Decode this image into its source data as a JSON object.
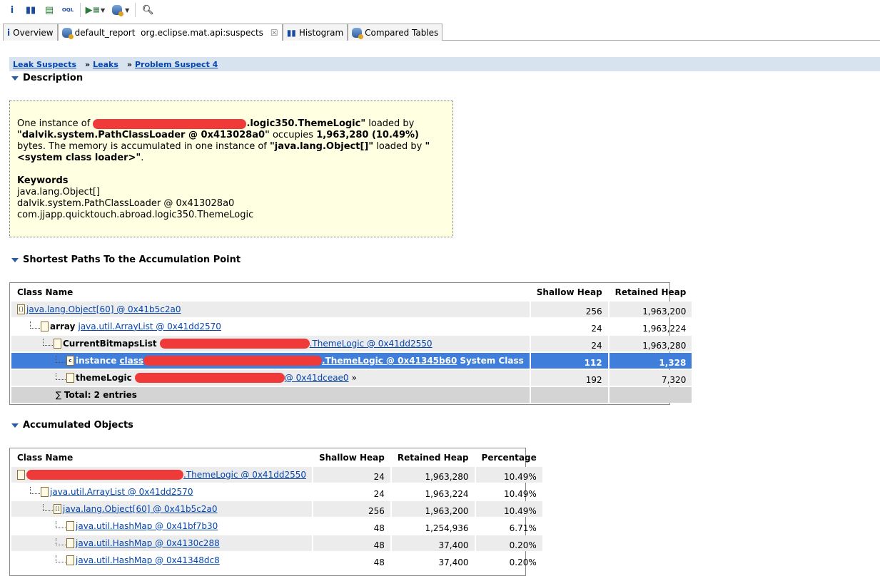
{
  "tabs": [
    {
      "label": "Overview",
      "icon": "info-icon"
    },
    {
      "label": "default_report  org.eclipse.mat.api:suspects",
      "icon": "report-icon",
      "closable": true
    },
    {
      "label": "Histogram",
      "icon": "histogram-icon"
    },
    {
      "label": "Compared Tables",
      "icon": "compare-icon"
    }
  ],
  "breadcrumb": [
    "Leak Suspects",
    "Leaks",
    "Problem Suspect 4"
  ],
  "breadcrumb_sep": "»",
  "description": {
    "title": "Description",
    "p1a": "One instance of ",
    "p1b": ".logic350.ThemeLogic\"",
    "p1c": " loaded by ",
    "p1d": "\"dalvik.system.PathClassLoader @ 0x413028a0\"",
    "p1e": " occupies ",
    "p1f": "1,963,280 (10.49%)",
    "p1g": " bytes. The memory is accumulated in one instance of ",
    "p1h": "\"java.lang.Object[]\"",
    "p1i": " loaded by ",
    "p1j": "\"<system class loader>\"",
    "p1k": ".",
    "kw_title": "Keywords",
    "keywords": [
      "java.lang.Object[]",
      "dalvik.system.PathClassLoader @ 0x413028a0",
      "com.jjapp.quicktouch.abroad.logic350.ThemeLogic"
    ]
  },
  "paths": {
    "title": "Shortest Paths To the Accumulation Point",
    "columns": [
      "Class Name",
      "Shallow Heap",
      "Retained Heap"
    ],
    "rows": [
      {
        "depth": 0,
        "icon": "[]",
        "field": "",
        "link": "java.lang.Object[60] @ 0x41b5c2a0",
        "extra": "",
        "shallow": "256",
        "retained": "1,963,200"
      },
      {
        "depth": 1,
        "icon": "",
        "field": "array",
        "link": "java.util.ArrayList @ 0x41dd2570",
        "extra": "",
        "shallow": "24",
        "retained": "1,963,224"
      },
      {
        "depth": 2,
        "icon": "",
        "field": "CurrentBitmapsList",
        "redact": true,
        "link": ".ThemeLogic @ 0x41dd2550",
        "extra": "",
        "shallow": "24",
        "retained": "1,963,280"
      },
      {
        "depth": 3,
        "icon": "c",
        "field": "instance",
        "pre": "class",
        "redact": true,
        "link": ".ThemeLogic @ 0x41345b60",
        "extra": "System Class",
        "shallow": "112",
        "retained": "1,328",
        "selected": true
      },
      {
        "depth": 3,
        "icon": "",
        "field": "themeLogic",
        "redact": true,
        "link": "@ 0x41dceae0",
        "extra": "»",
        "shallow": "192",
        "retained": "7,320"
      }
    ],
    "total": "Total: 2 entries"
  },
  "accumulated": {
    "title": "Accumulated Objects",
    "columns": [
      "Class Name",
      "Shallow Heap",
      "Retained Heap",
      "Percentage"
    ],
    "rows": [
      {
        "depth": 0,
        "icon": "",
        "redact": true,
        "link": ".ThemeLogic @ 0x41dd2550",
        "shallow": "24",
        "retained": "1,963,280",
        "pct": "10.49%"
      },
      {
        "depth": 1,
        "icon": "",
        "link": "java.util.ArrayList @ 0x41dd2570",
        "shallow": "24",
        "retained": "1,963,224",
        "pct": "10.49%"
      },
      {
        "depth": 2,
        "icon": "[]",
        "link": "java.lang.Object[60] @ 0x41b5c2a0",
        "shallow": "256",
        "retained": "1,963,200",
        "pct": "10.49%"
      },
      {
        "depth": 3,
        "icon": "",
        "link": "java.util.HashMap @ 0x41bf7b30",
        "shallow": "48",
        "retained": "1,254,936",
        "pct": "6.71%"
      },
      {
        "depth": 3,
        "icon": "",
        "link": "java.util.HashMap @ 0x4130c288",
        "shallow": "48",
        "retained": "37,400",
        "pct": "0.20%"
      },
      {
        "depth": 3,
        "icon": "",
        "link": "java.util.HashMap @ 0x41348dc8",
        "shallow": "48",
        "retained": "37,400",
        "pct": "0.20%"
      }
    ]
  }
}
